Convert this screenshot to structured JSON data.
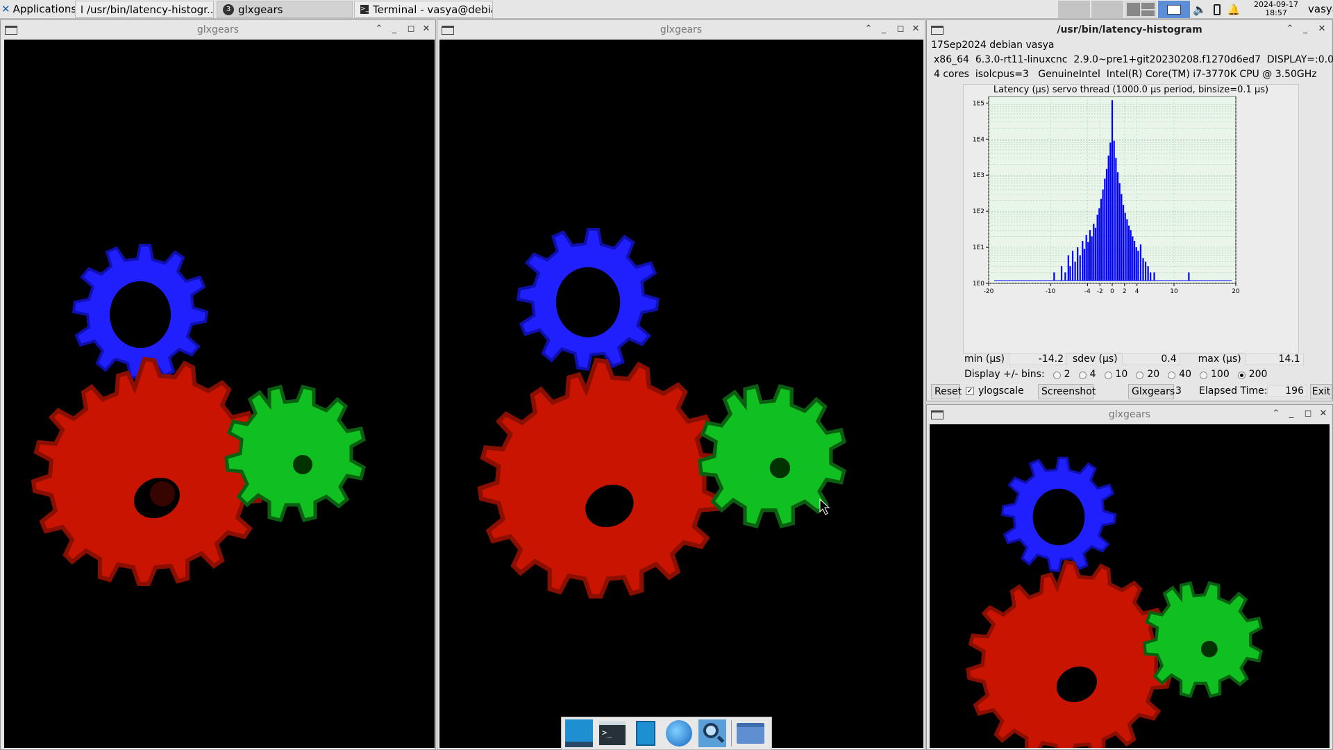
{
  "panel": {
    "apps_label": "Applications",
    "tasks": [
      {
        "label": "/usr/bin/latency-histogr..."
      },
      {
        "label": "glxgears",
        "badge": "3"
      },
      {
        "label": "Terminal - vasya@debia..."
      }
    ],
    "date": "2024-09-17",
    "time": "18:57",
    "user": "vasya"
  },
  "windows": {
    "glx1": {
      "title": "glxgears"
    },
    "glx2": {
      "title": "glxgears"
    },
    "glx3": {
      "title": "glxgears"
    },
    "latency": {
      "title": "/usr/bin/latency-histogram",
      "info1": "17Sep2024 debian vasya",
      "info2": "x86_64  6.3.0-rt11-linuxcnc  2.9.0~pre1+git20230208.f1270d6ed7  DISPLAY=:0.0",
      "info3": "4 cores  isolcpus=3   GenuineIntel  Intel(R) Core(TM) i7-3770K CPU @ 3.50GHz",
      "min_label": "min (µs)",
      "min_value": "-14.2",
      "sdev_label": "sdev (µs)",
      "sdev_value": "0.4",
      "max_label": "max (µs)",
      "max_value": "14.1",
      "bins_label": "Display +/- bins:",
      "bins": [
        "2",
        "4",
        "10",
        "20",
        "40",
        "100",
        "200"
      ],
      "bins_selected": "200",
      "reset": "Reset",
      "ylog": "ylogscale",
      "ylog_checked": true,
      "screenshot": "Screenshot",
      "glxgears_btn": "Glxgears",
      "glxgears_count": "3",
      "elapsed_label": "Elapsed Time:",
      "elapsed_value": "196",
      "exit": "Exit"
    }
  },
  "chart_data": {
    "type": "bar",
    "title": "Latency (µs) servo thread (1000.0 µs period, binsize=0.1 µs)",
    "xlabel": "",
    "ylabel": "",
    "xlim": [
      -20,
      20
    ],
    "ylim_log10": [
      0,
      5.2
    ],
    "yscale": "log",
    "xticks": [
      -20,
      -10,
      -4,
      -2,
      0,
      2,
      4,
      10,
      20
    ],
    "yticks": [
      "1E0",
      "1E1",
      "1E2",
      "1E3",
      "1E4",
      "1E5"
    ],
    "grid": true,
    "color": "#0000ff",
    "points": [
      [
        -14.2,
        1
      ],
      [
        -12.5,
        1
      ],
      [
        -11.0,
        1
      ],
      [
        -10.2,
        1
      ],
      [
        -9.4,
        2
      ],
      [
        -8.8,
        1
      ],
      [
        -8.2,
        3
      ],
      [
        -7.6,
        2
      ],
      [
        -7.1,
        6
      ],
      [
        -6.8,
        3
      ],
      [
        -6.4,
        8
      ],
      [
        -6.0,
        4
      ],
      [
        -5.6,
        10
      ],
      [
        -5.2,
        6
      ],
      [
        -4.8,
        15
      ],
      [
        -4.5,
        9
      ],
      [
        -4.2,
        22
      ],
      [
        -3.9,
        14
      ],
      [
        -3.6,
        30
      ],
      [
        -3.3,
        20
      ],
      [
        -3.0,
        45
      ],
      [
        -2.7,
        35
      ],
      [
        -2.4,
        80
      ],
      [
        -2.1,
        120
      ],
      [
        -1.8,
        220
      ],
      [
        -1.5,
        400
      ],
      [
        -1.2,
        800
      ],
      [
        -0.9,
        1500
      ],
      [
        -0.6,
        3500
      ],
      [
        -0.3,
        8000
      ],
      [
        0.0,
        120000
      ],
      [
        0.3,
        9000
      ],
      [
        0.6,
        3000
      ],
      [
        0.9,
        1200
      ],
      [
        1.2,
        600
      ],
      [
        1.5,
        300
      ],
      [
        1.8,
        150
      ],
      [
        2.1,
        90
      ],
      [
        2.4,
        60
      ],
      [
        2.7,
        40
      ],
      [
        3.0,
        30
      ],
      [
        3.3,
        20
      ],
      [
        3.6,
        15
      ],
      [
        3.9,
        10
      ],
      [
        4.2,
        8
      ],
      [
        4.6,
        12
      ],
      [
        5.0,
        5
      ],
      [
        5.4,
        4
      ],
      [
        5.8,
        3
      ],
      [
        6.2,
        2
      ],
      [
        6.8,
        2
      ],
      [
        7.4,
        1
      ],
      [
        8.2,
        1
      ],
      [
        9.6,
        1
      ],
      [
        11.0,
        1
      ],
      [
        12.4,
        2
      ],
      [
        14.1,
        1
      ]
    ]
  },
  "dock": {
    "items": [
      "desktop-icon",
      "terminal-icon",
      "file-manager-icon",
      "web-browser-icon",
      "app-finder-icon",
      "folder-icon"
    ]
  }
}
